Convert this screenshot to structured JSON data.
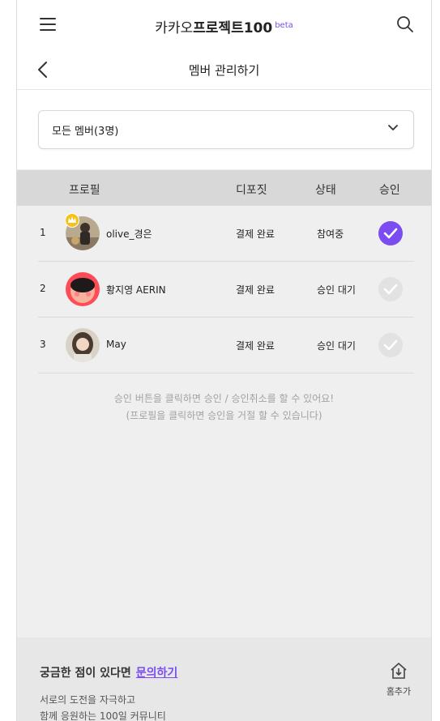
{
  "header": {
    "brand_prefix": "카카오",
    "brand_bold": "프로젝트100",
    "brand_sup": "beta",
    "menu_icon": "hamburger-icon",
    "search_icon": "search-icon"
  },
  "subheader": {
    "title": "멤버 관리하기",
    "back_icon": "chevron-left-icon"
  },
  "filter": {
    "selected": "모든 멤버(3명)",
    "icon": "chevron-down-icon"
  },
  "table": {
    "columns": {
      "profile": "프로필",
      "deposit": "디포짓",
      "status": "상태",
      "approve": "승인"
    },
    "rows": [
      {
        "num": "1",
        "name": "olive_경은",
        "deposit": "결제 완료",
        "status": "참여중",
        "approved": true,
        "leader": true
      },
      {
        "num": "2",
        "name": "황지영 AERIN",
        "deposit": "결제 완료",
        "status": "승인 대기",
        "approved": false,
        "leader": false
      },
      {
        "num": "3",
        "name": "May",
        "deposit": "결제 완료",
        "status": "승인 대기",
        "approved": false,
        "leader": false
      }
    ]
  },
  "notice": {
    "line1": "승인 버튼을 클릭하면 승인 / 승인취소를 할 수 있어요!",
    "line2": "(프로필을 클릭하면 승인을 거절 할 수 있습니다)"
  },
  "footer": {
    "question": "궁금한 점이 있다면",
    "link": "문의하기",
    "desc1": "서로의 도전을 자극하고",
    "desc2": "함께 응원하는 100일 커뮤니티",
    "home_add_label": "홈추가"
  },
  "colors": {
    "accent": "#7b4cf1",
    "inactive": "#e2e2e2"
  }
}
